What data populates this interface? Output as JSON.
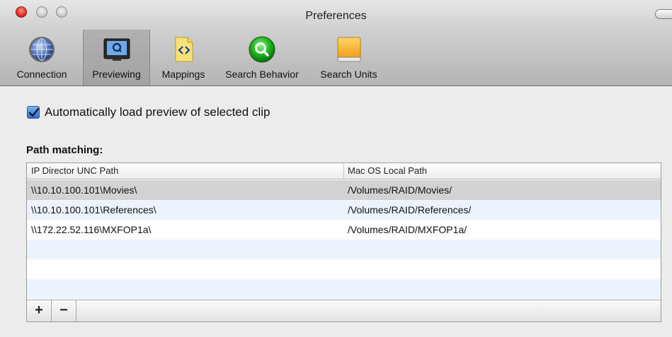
{
  "window": {
    "title": "Preferences"
  },
  "toolbar": {
    "items": [
      {
        "label": "Connection",
        "icon": "globe-icon",
        "selected": false
      },
      {
        "label": "Previewing",
        "icon": "monitor-icon",
        "selected": true
      },
      {
        "label": "Mappings",
        "icon": "code-document-icon",
        "selected": false
      },
      {
        "label": "Search Behavior",
        "icon": "magnifier-icon",
        "selected": false
      },
      {
        "label": "Search Units",
        "icon": "drive-icon",
        "selected": false
      }
    ]
  },
  "preview": {
    "auto_load_label": "Automatically load preview of selected clip",
    "auto_load_checked": true
  },
  "path_matching": {
    "heading": "Path matching:",
    "columns": [
      "IP Director UNC Path",
      "Mac OS Local Path"
    ],
    "rows": [
      {
        "unc": "\\\\10.10.100.101\\Movies\\",
        "local": "/Volumes/RAID/Movies/"
      },
      {
        "unc": "\\\\10.10.100.101\\References\\",
        "local": "/Volumes/RAID/References/"
      },
      {
        "unc": "\\\\172.22.52.116\\MXFOP1a\\",
        "local": "/Volumes/RAID/MXFOP1a/"
      }
    ],
    "selected_row": 0,
    "add_label": "+",
    "remove_label": "−"
  },
  "colors": {
    "accent": "#2a6fd0",
    "row_alt": "#edf3fe",
    "row_selected": "#d2d2d2"
  }
}
